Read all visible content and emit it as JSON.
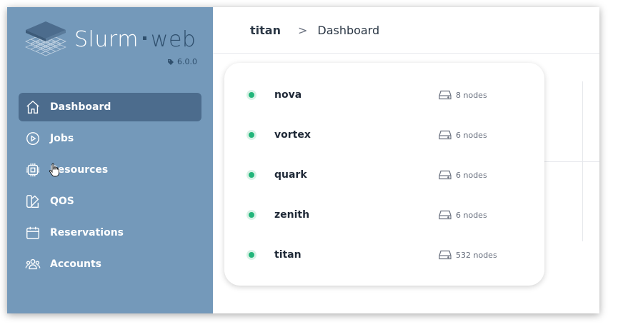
{
  "app": {
    "logo_text_main": "Slurm",
    "logo_text_accent": "web",
    "version": "6.0.0",
    "brand_color": "#7499ba",
    "active_color": "#4c6c8d",
    "accent_dark": "#2f4f6d"
  },
  "sidebar": {
    "items": [
      {
        "label": "Dashboard",
        "icon": "home-icon",
        "active": true
      },
      {
        "label": "Jobs",
        "icon": "play-circle-icon",
        "active": false
      },
      {
        "label": "Resources",
        "icon": "cpu-icon",
        "active": false
      },
      {
        "label": "QOS",
        "icon": "swatch-icon",
        "active": false
      },
      {
        "label": "Reservations",
        "icon": "calendar-icon",
        "active": false
      },
      {
        "label": "Accounts",
        "icon": "users-icon",
        "active": false
      }
    ]
  },
  "breadcrumb": {
    "cluster": "titan",
    "separator": ">",
    "page": "Dashboard"
  },
  "clusters": [
    {
      "name": "nova",
      "nodes": "8 nodes",
      "status_color": "#22b57a"
    },
    {
      "name": "vortex",
      "nodes": "6 nodes",
      "status_color": "#22b57a"
    },
    {
      "name": "quark",
      "nodes": "6 nodes",
      "status_color": "#22b57a"
    },
    {
      "name": "zenith",
      "nodes": "6 nodes",
      "status_color": "#22b57a"
    },
    {
      "name": "titan",
      "nodes": "532 nodes",
      "status_color": "#22b57a"
    }
  ]
}
